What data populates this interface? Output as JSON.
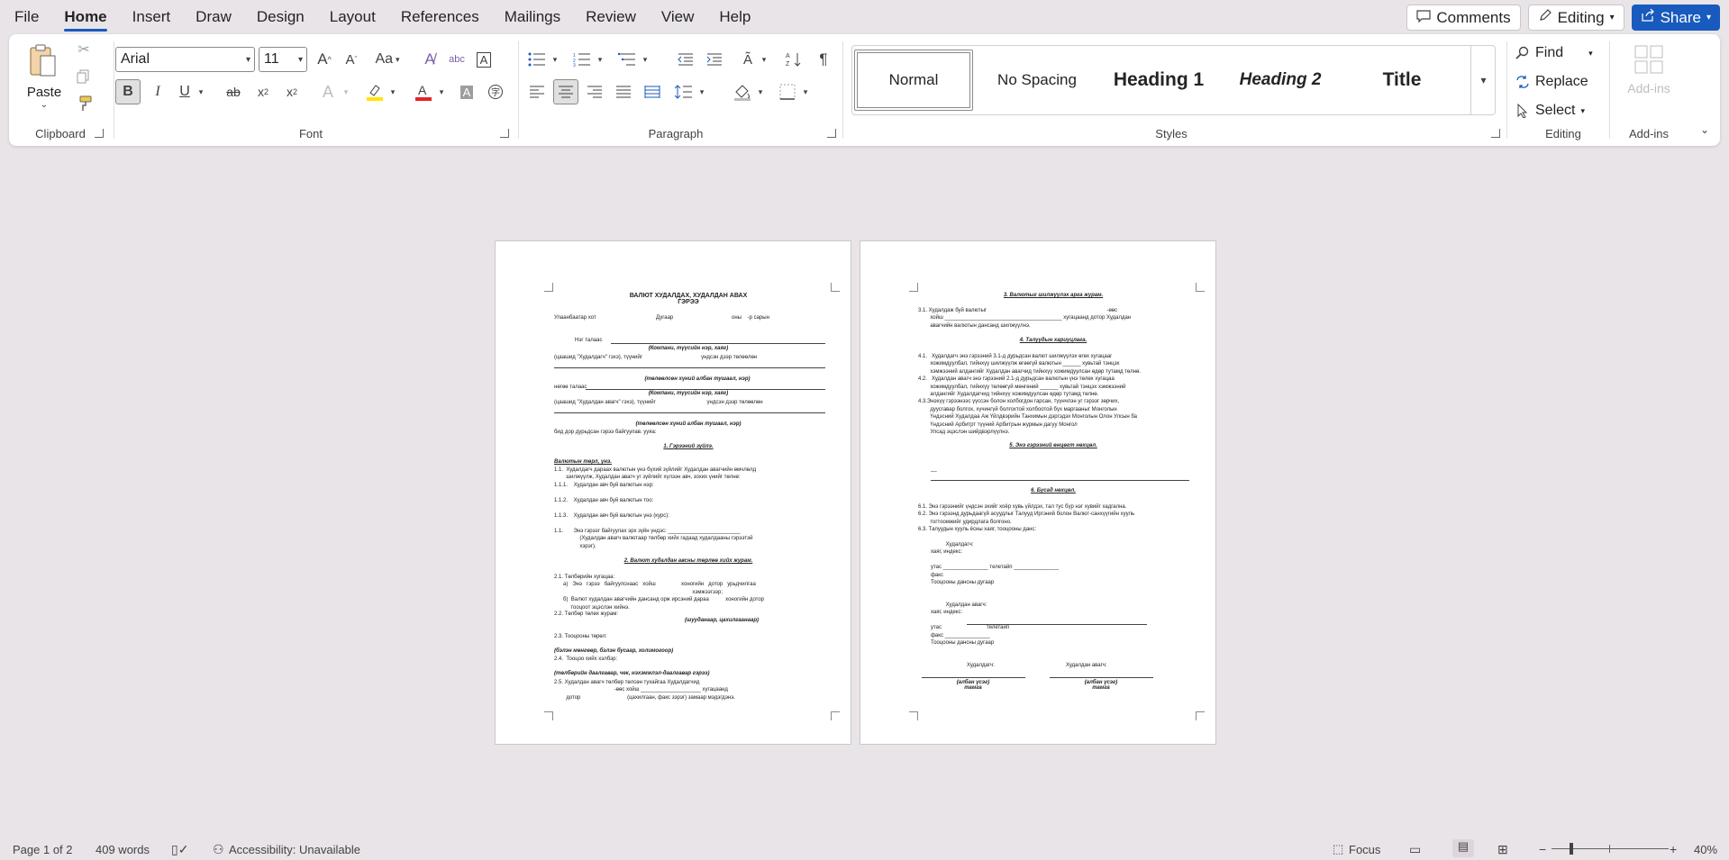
{
  "menu": {
    "tabs": [
      "File",
      "Home",
      "Insert",
      "Draw",
      "Design",
      "Layout",
      "References",
      "Mailings",
      "Review",
      "View",
      "Help"
    ],
    "active": "Home"
  },
  "top_right": {
    "comments_label": "Comments",
    "editing_label": "Editing",
    "share_label": "Share"
  },
  "ribbon": {
    "clipboard": {
      "paste_label": "Paste",
      "group_label": "Clipboard"
    },
    "font": {
      "font_name": "Arial",
      "font_size": "11",
      "group_label": "Font",
      "case_label": "Aa"
    },
    "paragraph": {
      "group_label": "Paragraph"
    },
    "styles": {
      "group_label": "Styles",
      "items": [
        "Normal",
        "No Spacing",
        "Heading 1",
        "Heading 2",
        "Title"
      ],
      "selected": "Normal"
    },
    "editing": {
      "group_label": "Editing",
      "find_label": "Find",
      "replace_label": "Replace",
      "select_label": "Select"
    },
    "addins": {
      "label": "Add-ins",
      "group_label": "Add-ins"
    }
  },
  "colors": {
    "accent": "#185abd",
    "highlight": "#ffe600",
    "font_color": "#e3242b"
  },
  "page1": {
    "title_line1": "ВАЛЮТ ХУДАЛДАХ, ХУДАЛДАН АВАХ",
    "title_line2": "ГЭРЭЭ",
    "city": "Улаанбаатар хот",
    "number": "Дугаар",
    "date": "оны    -р сарын",
    "party1": "Нэг талаас",
    "party1_company": "(Компани, түүсийн нэр, хаяг)",
    "party1_rep": "(цаашид \"Худалдагч\" гэхэ), түүнийг                                       үндсэн дээр төлөөлөн",
    "party1_sign": "(төлөөлсөн хүний албан тушаал, нэр)",
    "party2": "нөгөө талаас",
    "party2_company": "(Компани, түүсийн нэр, хаяг)",
    "party2_rep": "(цаашид \"Худалдан авагч\" гэхэ), түүнийг                                  үндсэн дээр төлөөлөн",
    "party2_sign": "(төлөөлсөн хүний албан тушаал, нэр)",
    "agreement": "бид дор дурьдсан гэрээ байгуулав. ууяа:",
    "sec1_head": "1. Гэрээний зүйлэ.",
    "sec1_sub": "Валютын төрл, үнэ.",
    "sec1_1": "1.1.  Худалдагч дараах валютын үнэ бүхий зүйлийг Худалдан авагчийн өмчлөлд\n        шилжүүлж, Худалдан авагч уг зүйлийг хүлээн авч, зохих үнийг төлнө:",
    "sec1_1_1": "1.1.1.    Худалдан авч буй валютын нэр:",
    "sec1_1_2": "1.1.2.    Худалдан авч буй валютын тоо:",
    "sec1_1_3": "1.1.3.    Худалдан авч буй валютын үнэ (курс):",
    "sec1_2": "1.1.       Энэ гэрээг байгуулах эрх зүйн үндэс: ________________________\n                 (Худалдан авагч валютаар төлбөр хийх гадаад худалдааны гэрээтэй\n                 хэрэг).",
    "sec2_head": "2. Валют худалдан авсны төрлөө хийх журам.",
    "sec2_1": "2.1. Төлбөрийн хугацаа:\n      а)   Энэ   гэрээ   байгуулснаас   хойш                 хоногийн   дотор   урьдчилгаа\n                                                                                            хэмжээгээр;\n      б)  Валют худалдан авагчийн дансанд орж ирсэний дараа           хоногийн дотор\n           тооцоот эцэслэн хийнэ.",
    "sec2_2": "2.2. Төлбөр төлөх журам:",
    "sec2_2_note": "(шууданаар, цахилгаанаар)",
    "sec2_3": "2.3. Тооцооны төрөл:",
    "sec2_3_note": "(бэлэн мөнгөөр, бэлэн бусаар, холимогоор)",
    "sec2_4": "2.4.  Тооцоо хийх хэлбэр:",
    "sec2_4_note": "(төлбөрийн даалгавар, чек, нэхэмжлэл-даалгавар гэрээ)",
    "sec2_5": "2.5. Худалдан авагч төлбөр төлсөн тухайгаа Худалдагчид\n                                        -өөс хойш ____________________ хугацаанд\n        дотор                               (цахилгаан, факс зэрэг) замаар мэдэгдэнэ."
  },
  "page2": {
    "sec3_head": "3. Валютыг шилжүүлэх арга журам.",
    "sec3_1": "3.1. Худалдаж буй валютыг                                                                                -өөс\n        хойш _______________________________________ хугацаанд дотор Худалдан\n        авагчийн валютын дансанд шилжүүлнэ.",
    "sec4_head": "4. Талуудын хариуцлага.",
    "sec4": "4.1.   Худалдагч энэ гэрээний 3.1-д дурьдсан валют шилжүүлэх өгөх хугацааг\n        хожимдуулбал, тийнхүү шилжүүлж өгөөгүй валютын ______ хувьтай тэнцэх\n        хэмжээний алдангийг Худалдан авагчид тийнхүү хожимдуулсан өдөр тутамд төлнө.\n4.2.   Худалдан авагч энэ гэрээний 2.1-д дурьдсан валютын үнэ төлөх хугацаа\n        хожимдуулбал, тийнхүү төлөөгүй мөнгөний ______ хувьтай тэнцэх хэмжээний\n        алдангийг Худалдагчид тийнхүү хожимдуулсан өдөр тутамд төлнө.\n4.3.Энэхүү гэрээнээс үүссэн болон холбогдон гарсан, түүнчлэн уг гэрээг зөрчих,\n        дуусгавар болгох, хүчингүй болгохтой холбоотой бүх маргааныг Монголын\n        Үндэсний Худалдаа Аж Үйлдвэрийн Танхимын дэргэдэх Монголын Олон Улсын ба\n        Үндэсний Арбитрт түүний Арбитрын журмын дагуу Монгол\n        Улсад эцэслэн шийдвэрлүүлнэ.",
    "sec5_head": "5. Энэ гэрээний өнцөгт нөхцөл.",
    "sec5_body": "__",
    "sec6_head": "6. Бусад нөхцөл.",
    "sec6": "6.1. Энэ гэрээнийг үндсэн эхийг хоёр хувь үйлдэх, тал тус бүр нэг хувийг хадгална.\n6.2. Энэ гэрээнд дурьдаагүй асуудлыг Талууд Иргэний болон Валют-санхүүгийн хууль\n        тогтоомжийг удирдлага болгоно.\n6.3. Талуудын хууль ёсны хаяг, тооцооны данс:",
    "seller_block": "          Худалдагч:\nхаяг, индекс:\n\nутас _______________ телетайп _______________\nфакс\nТооцооны дансны дугаар",
    "buyer_block": "          Худалдан авагч:\nхаяг, индекс:\n\nутас                              телетайп\nфакс _______________\nТооцооны дансны дугаар",
    "sign_seller": "Худалдагч:",
    "sign_buyer": "Худалдан авагч:",
    "sign_note1": "(албан үсэг)\nтамга",
    "sign_note2": "(албан үсэг)\nтамга"
  },
  "status": {
    "page": "Page 1 of 2",
    "words": "409 words",
    "accessibility": "Accessibility: Unavailable",
    "focus": "Focus",
    "zoom": "40%"
  }
}
